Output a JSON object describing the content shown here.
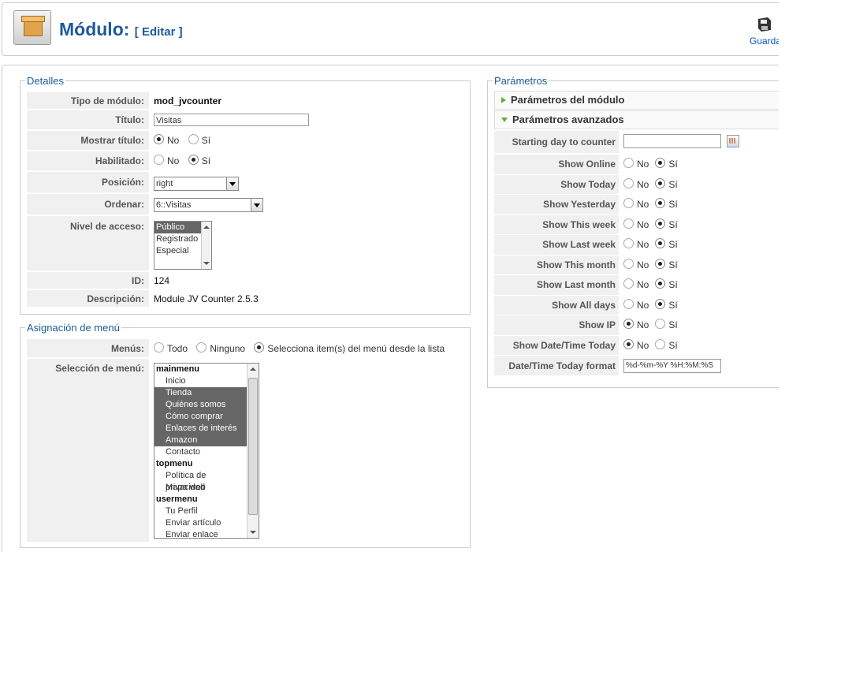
{
  "header": {
    "title": "Módulo:",
    "subtitle": "[ Editar ]",
    "save_label": "Guarda"
  },
  "details": {
    "legend": "Detalles",
    "module_type_label": "Tipo de módulo:",
    "module_type_value": "mod_jvcounter",
    "title_label": "Título:",
    "title_value": "Visitas",
    "show_title_label": "Mostrar título:",
    "enabled_label": "Habilitado:",
    "position_label": "Posición:",
    "position_value": "right",
    "order_label": "Ordenar:",
    "order_value": "6::Visitas",
    "access_label": "Nivel de acceso:",
    "access_options": [
      "Público",
      "Registrado",
      "Especial"
    ],
    "id_label": "ID:",
    "id_value": "124",
    "description_label": "Descripción:",
    "description_value": "Module JV Counter 2.5.3",
    "opt_no": "No",
    "opt_si": "Sí"
  },
  "menu_assignment": {
    "legend": "Asignación de menú",
    "menus_label": "Menús:",
    "opt_all": "Todo",
    "opt_none": "Ninguno",
    "opt_select": "Selecciona item(s) del menú desde la lista",
    "selection_label": "Selección de menú:",
    "items": [
      {
        "label": "mainmenu",
        "type": "group"
      },
      {
        "label": "Inicio",
        "type": "item"
      },
      {
        "label": "Tienda",
        "type": "selected"
      },
      {
        "label": "Quiénes somos",
        "type": "selected"
      },
      {
        "label": "Cómo comprar",
        "type": "selected"
      },
      {
        "label": "Enlaces de interés",
        "type": "selected"
      },
      {
        "label": "Amazon",
        "type": "selected"
      },
      {
        "label": "Contacto",
        "type": "item"
      },
      {
        "label": "topmenu",
        "type": "group"
      },
      {
        "label": "Política de privacidad",
        "type": "item"
      },
      {
        "label": "Mapa web",
        "type": "item"
      },
      {
        "label": "usermenu",
        "type": "group"
      },
      {
        "label": "Tu Perfil",
        "type": "item"
      },
      {
        "label": "Enviar artículo",
        "type": "item"
      },
      {
        "label": "Enviar enlace",
        "type": "item"
      }
    ]
  },
  "params": {
    "legend": "Parámetros",
    "module_params": "Parámetros del módulo",
    "advanced_params": "Parámetros avanzados",
    "starting_day_label": "Starting day to counter",
    "rows": [
      {
        "label": "Show Online",
        "value": "si"
      },
      {
        "label": "Show Today",
        "value": "si"
      },
      {
        "label": "Show Yesterday",
        "value": "si"
      },
      {
        "label": "Show This week",
        "value": "si"
      },
      {
        "label": "Show Last week",
        "value": "si"
      },
      {
        "label": "Show This month",
        "value": "si"
      },
      {
        "label": "Show Last month",
        "value": "si"
      },
      {
        "label": "Show All days",
        "value": "si"
      },
      {
        "label": "Show IP",
        "value": "no"
      },
      {
        "label": "Show Date/Time Today",
        "value": "no"
      }
    ],
    "format_label": "Date/Time Today format",
    "format_value": "%d-%m-%Y %H:%M:%S",
    "opt_no": "No",
    "opt_si": "Sí"
  }
}
